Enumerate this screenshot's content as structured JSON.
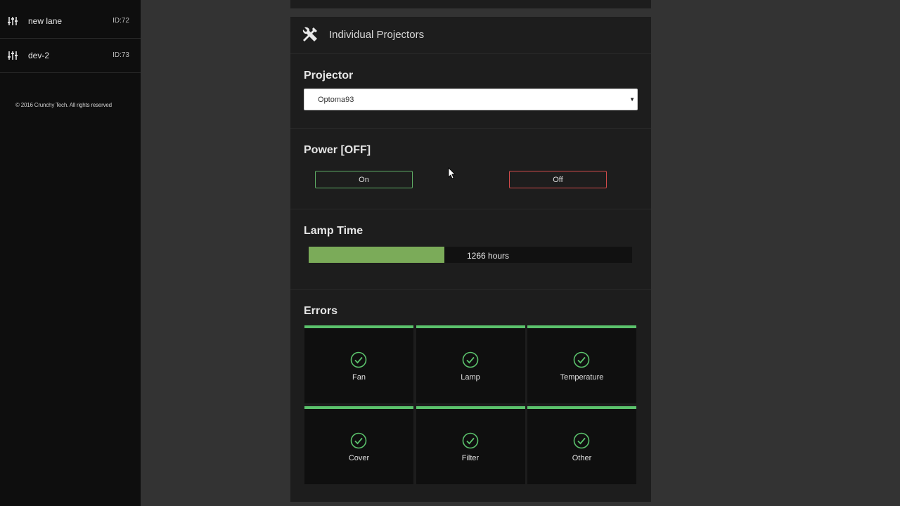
{
  "sidebar": {
    "items": [
      {
        "label": "new lane",
        "id": "ID:72",
        "icon": "sliders-icon"
      },
      {
        "label": "dev-2",
        "id": "ID:73",
        "icon": "sliders-icon"
      }
    ],
    "copyright": "© 2016 Crunchy Tech. All rights reserved"
  },
  "panel": {
    "title": "Individual Projectors",
    "icon": "tools-icon",
    "projector": {
      "heading": "Projector",
      "selected": "Optoma93"
    },
    "power": {
      "heading": "Power [OFF]",
      "on_label": "On",
      "off_label": "Off",
      "on_color": "#5fae66",
      "off_color": "#d24b4b"
    },
    "lamp": {
      "heading": "Lamp Time",
      "text": "1266 hours",
      "fill_fraction": 0.42,
      "color": "#7bab59"
    },
    "errors": {
      "heading": "Errors",
      "status_color": "#5bc26c",
      "items": [
        {
          "label": "Fan",
          "status": "ok"
        },
        {
          "label": "Lamp",
          "status": "ok"
        },
        {
          "label": "Temperature",
          "status": "ok"
        },
        {
          "label": "Cover",
          "status": "ok"
        },
        {
          "label": "Filter",
          "status": "ok"
        },
        {
          "label": "Other",
          "status": "ok"
        }
      ]
    }
  }
}
